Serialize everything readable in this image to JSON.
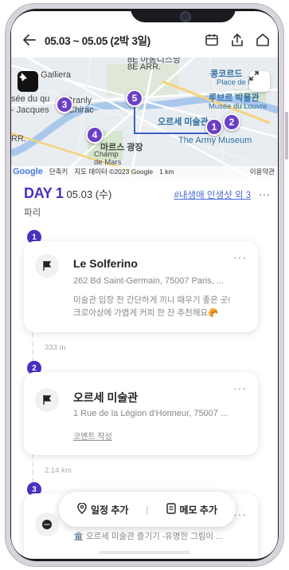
{
  "header": {
    "title": "05.03 ~ 05.05 (2박 3일)",
    "icons": [
      "back-arrow-icon",
      "calendar-icon",
      "share-icon",
      "home-icon"
    ]
  },
  "map": {
    "labels": {
      "top": "8E ARR.",
      "arr8e_kr": "8E 아롱디스망",
      "galleria": "ais Galliera",
      "concorde": "콩코르드",
      "place_concorde": "Place de l",
      "seine_left": "sée du qu",
      "jacques": "- Jacques",
      "chirac": "Chirac",
      "branly": "Branly",
      "louvre_kr": "루브르 박물관",
      "louvre": "Musée du Louvre",
      "orsay_kr": "오르세 미술관",
      "army": "The Army Museum",
      "mars_kr": "마르스 광장",
      "champ": "Champ",
      "mars": "de Mars",
      "rr": "RR."
    },
    "pins": [
      "1",
      "2",
      "3",
      "4",
      "5"
    ],
    "footer": {
      "google": "Google",
      "shortcut": "단축키",
      "mapdata": "지도 데이터 ©2023 Google",
      "scale": "1 km",
      "terms": "이용약관"
    }
  },
  "day": {
    "label": "DAY 1",
    "date": "05.03 (수)",
    "tag": "#내생애 인생샷 외 3",
    "more": "···",
    "city": "파리"
  },
  "places": [
    {
      "number": "1",
      "title": "Le Solferino",
      "address": "262 Bd Saint-Germain, 75007 Paris, ...",
      "memo_line1": "미술관 입장 전 간단하게 끼니 때우기 좋은 곳!",
      "memo_line2": "크로아상에 가볍게 커피 한 잔 추천해요🥐",
      "more": "···"
    },
    {
      "number": "2",
      "title": "오르세 미술관",
      "address": "1 Rue de la Légion d'Honneur, 75007 ...",
      "comment": "코멘트 작성",
      "more": "···"
    },
    {
      "number": "3",
      "memo_line1": "🏛️ 오르세 미술관 즐기기 -유명한 그림이 ...",
      "more": "···"
    }
  ],
  "distances": [
    "333 m",
    "2.14 km"
  ],
  "actions": {
    "add_schedule": "일정 추가",
    "separator": "|",
    "add_memo": "메모 추가"
  },
  "colors": {
    "accent": "#4a2fc0",
    "pin": "#6b3fc6",
    "tag": "#4a6ad0"
  }
}
